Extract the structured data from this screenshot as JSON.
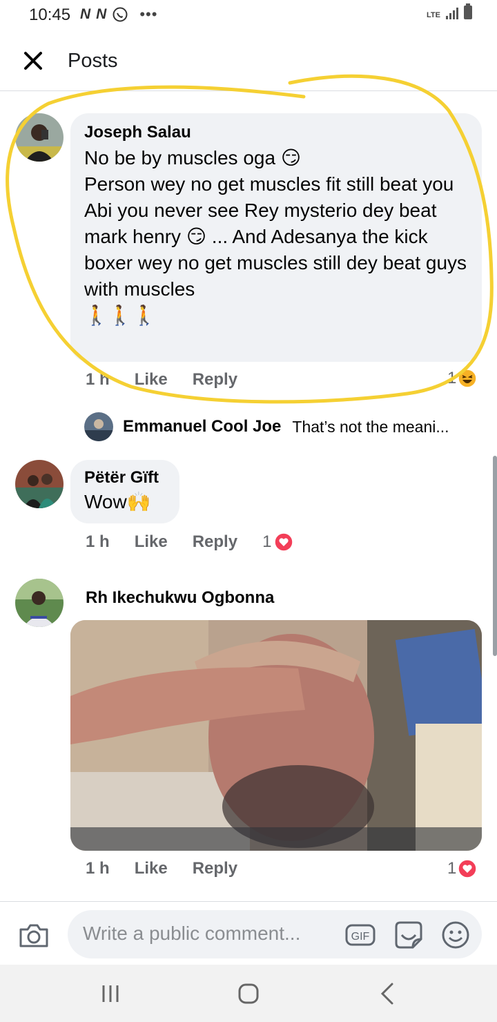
{
  "status": {
    "time": "10:45",
    "net_icons": [
      "N",
      "N"
    ],
    "more": "•••",
    "lte": "LTE"
  },
  "header": {
    "title": "Posts"
  },
  "comments": [
    {
      "author": "Joseph Salau",
      "text": "No be by muscles oga 😏\nPerson wey no get muscles fit still beat you\nAbi you never see Rey mysterio dey beat mark henry 😏 ... And Adesanya the kick boxer wey no get muscles still dey beat guys with muscles\n🚶🚶🚶",
      "time": "1 h",
      "like": "Like",
      "reply": "Reply",
      "reaction_count": "1",
      "reaction": "haha"
    },
    {
      "author": "Pëtër Gïft",
      "text": "Wow🙌",
      "time": "1 h",
      "like": "Like",
      "reply": "Reply",
      "reaction_count": "1",
      "reaction": "love"
    },
    {
      "author": "Rh Ikechukwu Ogbonna",
      "time": "1 h",
      "like": "Like",
      "reply": "Reply",
      "reaction_count": "1",
      "reaction": "love"
    }
  ],
  "reply_preview": {
    "author": "Emmanuel Cool Joe",
    "text": "That’s not the meani..."
  },
  "composer": {
    "placeholder": "Write a public comment..."
  },
  "colors": {
    "bubble": "#f0f2f5",
    "muted_text": "#65676b",
    "highlight_circle": "#f5d033",
    "love_red": "#f33e58",
    "haha_yellow": "#f7b125"
  }
}
